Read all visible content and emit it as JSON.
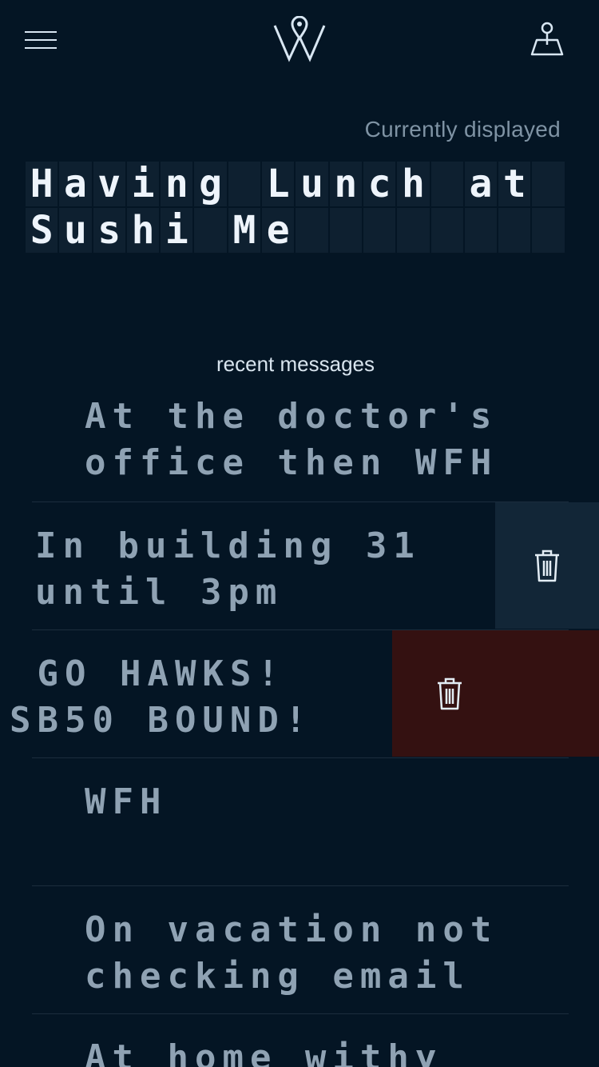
{
  "header": {
    "menu_icon": "hamburger-menu-icon",
    "logo_icon": "location-pin-w-logo",
    "map_icon": "map-pin-icon"
  },
  "current": {
    "label": "Currently displayed",
    "line1": "Having Lunch at",
    "line2": "Sushi Me"
  },
  "recent": {
    "title": "recent messages",
    "messages": [
      {
        "line1": "At the doctor's",
        "line2": "office then WFH"
      },
      {
        "line1": "In building 31",
        "line2": "until 3pm"
      },
      {
        "line1": " GO HAWKS!",
        "line2": "SB50 BOUND!"
      },
      {
        "line1": "WFH",
        "line2": ""
      },
      {
        "line1": "On vacation not",
        "line2": "checking email"
      },
      {
        "line1": "At home withy",
        "line2": ""
      }
    ]
  },
  "colors": {
    "background": "#041524",
    "cell": "#0e2030",
    "delete_idle": "#122637",
    "delete_active": "#341111"
  }
}
